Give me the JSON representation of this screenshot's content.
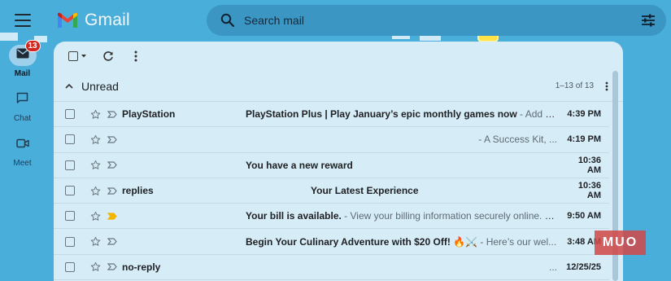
{
  "app": {
    "name": "Gmail"
  },
  "search": {
    "placeholder": "Search mail"
  },
  "rail": {
    "items": [
      {
        "label": "Mail",
        "badge": "13",
        "icon": "mail-icon"
      },
      {
        "label": "Chat",
        "icon": "chat-icon"
      },
      {
        "label": "Meet",
        "icon": "video-icon"
      }
    ]
  },
  "section": {
    "title": "Unread",
    "count": "1–13 of 13"
  },
  "emails": [
    {
      "sender": "PlayStation",
      "subject": "PlayStation Plus | Play January’s epic monthly games now",
      "snippet": " - Add o...",
      "time": "4:39 PM",
      "important": false
    },
    {
      "sender": "",
      "subject": "",
      "snippet": "- A Success Kit, ...",
      "time": "4:19 PM",
      "important": false
    },
    {
      "sender": "",
      "subject": "You have a new reward",
      "snippet": "",
      "time": "10:36 AM",
      "important": false
    },
    {
      "sender": "replies",
      "subject": "Your Latest Experience",
      "snippet": "",
      "time": "10:36 AM",
      "important": false
    },
    {
      "sender": "",
      "subject": "Your bill is available.",
      "snippet": " - View your billing information securely online. S...",
      "time": "9:50 AM",
      "important": true
    },
    {
      "sender": "",
      "subject": "Begin Your Culinary Adventure with $20 Off! 🔥⚔️",
      "snippet": " - Here’s our wel...",
      "time": "3:48 AM",
      "important": false
    },
    {
      "sender": "no-reply",
      "subject": "",
      "snippet": "...",
      "time": "12/25/25",
      "important": false
    }
  ],
  "watermark": "MUO",
  "colors": {
    "badge": "#d3261f",
    "important": "#f4b400",
    "background": "#4aaedb"
  }
}
